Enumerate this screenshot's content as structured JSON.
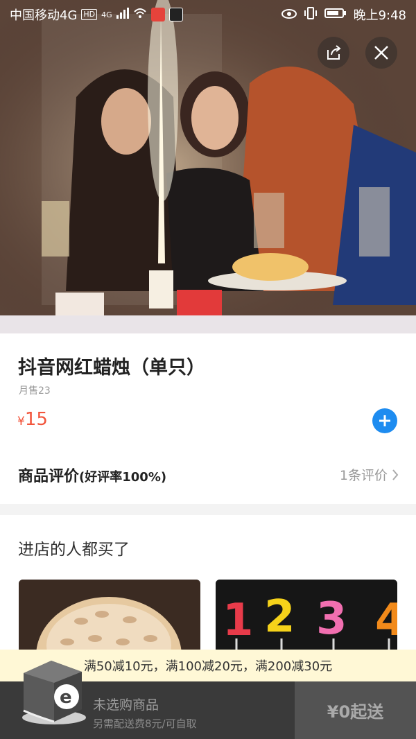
{
  "status_bar": {
    "carrier": "中国移动4G",
    "hd_badge": "HD",
    "network": "4G",
    "time": "晚上9:48"
  },
  "header": {
    "share_icon": "share-icon",
    "close_icon": "close-icon"
  },
  "product": {
    "name": "抖音网红蜡烛（单只）",
    "monthly_sales": "月售23",
    "currency": "¥",
    "price": "15",
    "add_icon": "plus-icon"
  },
  "reviews": {
    "title": "商品评价",
    "rate": "(好评率100%)",
    "count_link": "1条评价"
  },
  "recommendations": {
    "title": "进店的人都买了",
    "items": [
      {
        "name": "",
        "image": "almond-cake-image"
      },
      {
        "name": "",
        "image": "number-candles-image"
      }
    ]
  },
  "promo": {
    "text": "满50减10元，满100减20元，满200减30元"
  },
  "cart": {
    "empty_text": "未选购商品",
    "fee_text": "另需配送费8元/可自取",
    "checkout_label": "¥0起送"
  },
  "colors": {
    "price": "#f2553c",
    "accent": "#1e8cf0",
    "cart_bar": "#3a3a3a",
    "promo_bg": "#fff8d6"
  }
}
